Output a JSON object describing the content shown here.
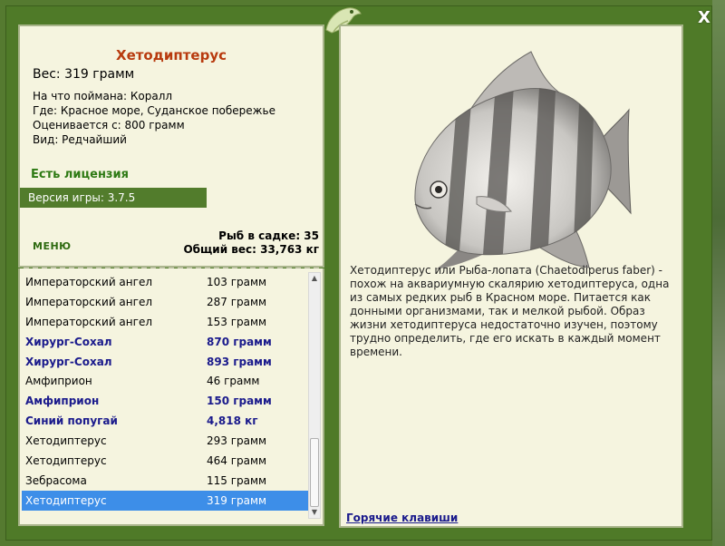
{
  "close_label": "X",
  "fish": {
    "title": "Хетодиптерус",
    "weight_line": "Вес: 319 грамм",
    "caught_on": "На что поймана: Коралл",
    "where": "Где: Красное море, Суданское побережье",
    "valued_from": "Оценивается с: 800 грамм",
    "kind": "Вид: Редчайший"
  },
  "license_label": "Есть лицензия",
  "version_label": "Версия игры: 3.7.5",
  "menu_label": "МЕНЮ",
  "cage": {
    "fish_count": "Рыб в садке: 35",
    "total_weight": "Общий вес: 33,763 кг"
  },
  "list": [
    {
      "name": "Императорский ангел",
      "weight": "103 грамм",
      "bold": false,
      "selected": false
    },
    {
      "name": "Императорский ангел",
      "weight": "287 грамм",
      "bold": false,
      "selected": false
    },
    {
      "name": "Императорский ангел",
      "weight": "153 грамм",
      "bold": false,
      "selected": false
    },
    {
      "name": "Хирург-Сохал",
      "weight": "870 грамм",
      "bold": true,
      "selected": false
    },
    {
      "name": "Хирург-Сохал",
      "weight": "893 грамм",
      "bold": true,
      "selected": false
    },
    {
      "name": "Амфиприон",
      "weight": "46 грамм",
      "bold": false,
      "selected": false
    },
    {
      "name": "Амфиприон",
      "weight": "150 грамм",
      "bold": true,
      "selected": false
    },
    {
      "name": "Синий попугай",
      "weight": "4,818 кг",
      "bold": true,
      "selected": false
    },
    {
      "name": "Хетодиптерус",
      "weight": "293 грамм",
      "bold": false,
      "selected": false
    },
    {
      "name": "Хетодиптерус",
      "weight": "464 грамм",
      "bold": false,
      "selected": false
    },
    {
      "name": "Зебрасома",
      "weight": "115 грамм",
      "bold": false,
      "selected": false
    },
    {
      "name": "Хетодиптерус",
      "weight": "319 грамм",
      "bold": false,
      "selected": true
    }
  ],
  "description": "Хетодиптерус или Рыба-лопата (Chaetodiperus faber) - похож на аквариумную скалярию хетодиптеруса, одна из самых редких рыб в Красном море. Питается как донными организмами, так и мелкой рыбой. Образ жизни хетодиптеруса недостаточно изучен, поэтому трудно определить, где его искать в каждый момент времени.",
  "hotkeys_label": "Горячие клавиши",
  "colors": {
    "frame_green": "#4f7a28",
    "panel_bg": "#f5f4df",
    "title_red": "#b83a0e",
    "license_green": "#2e7a14",
    "bold_blue": "#1a1a8c",
    "selection_blue": "#3d8ee8"
  }
}
